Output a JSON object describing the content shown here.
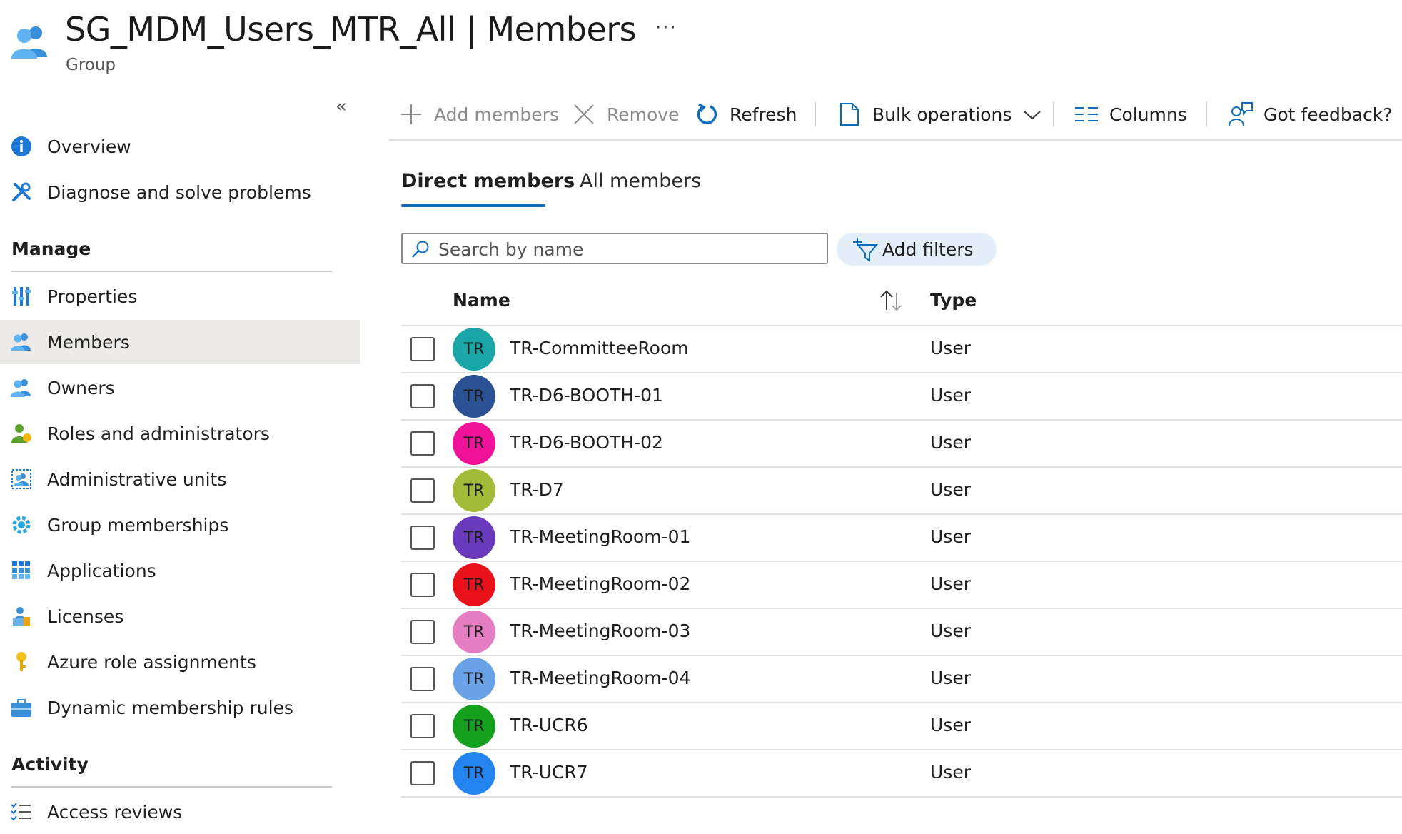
{
  "header": {
    "title": "SG_MDM_Users_MTR_All | Members",
    "subtitle": "Group",
    "more": "···",
    "collapse": "«"
  },
  "sidebar": {
    "top_items": [
      {
        "label": "Overview",
        "icon": "info-icon"
      },
      {
        "label": "Diagnose and solve problems",
        "icon": "wrench-icon"
      }
    ],
    "manage_heading": "Manage",
    "manage_items": [
      {
        "label": "Properties",
        "icon": "properties-icon"
      },
      {
        "label": "Members",
        "icon": "members-icon",
        "active": true
      },
      {
        "label": "Owners",
        "icon": "owners-icon"
      },
      {
        "label": "Roles and administrators",
        "icon": "roles-icon"
      },
      {
        "label": "Administrative units",
        "icon": "admin-units-icon"
      },
      {
        "label": "Group memberships",
        "icon": "group-memberships-icon"
      },
      {
        "label": "Applications",
        "icon": "applications-icon"
      },
      {
        "label": "Licenses",
        "icon": "licenses-icon"
      },
      {
        "label": "Azure role assignments",
        "icon": "key-icon"
      },
      {
        "label": "Dynamic membership rules",
        "icon": "toolbox-icon"
      }
    ],
    "activity_heading": "Activity",
    "activity_items": [
      {
        "label": "Access reviews",
        "icon": "checklist-icon"
      }
    ]
  },
  "toolbar": {
    "add_members": "Add members",
    "remove": "Remove",
    "refresh": "Refresh",
    "bulk_operations": "Bulk operations",
    "columns": "Columns",
    "feedback": "Got feedback?"
  },
  "tabs": {
    "direct": "Direct members",
    "all": "All members"
  },
  "search": {
    "placeholder": "Search by name",
    "value": ""
  },
  "filters": {
    "add_filters": "Add filters"
  },
  "table": {
    "columns": [
      "Name",
      "Type"
    ],
    "rows": [
      {
        "initials": "TR",
        "name": "TR-CommitteeRoom",
        "type": "User",
        "color": "#1aa6a6"
      },
      {
        "initials": "TR",
        "name": "TR-D6-BOOTH-01",
        "type": "User",
        "color": "#2c5296"
      },
      {
        "initials": "TR",
        "name": "TR-D6-BOOTH-02",
        "type": "User",
        "color": "#f0139a"
      },
      {
        "initials": "TR",
        "name": "TR-D7",
        "type": "User",
        "color": "#a4bb3a"
      },
      {
        "initials": "TR",
        "name": "TR-MeetingRoom-01",
        "type": "User",
        "color": "#6a3bbd"
      },
      {
        "initials": "TR",
        "name": "TR-MeetingRoom-02",
        "type": "User",
        "color": "#e9121b"
      },
      {
        "initials": "TR",
        "name": "TR-MeetingRoom-03",
        "type": "User",
        "color": "#e57dc2"
      },
      {
        "initials": "TR",
        "name": "TR-MeetingRoom-04",
        "type": "User",
        "color": "#6aa2e8"
      },
      {
        "initials": "TR",
        "name": "TR-UCR6",
        "type": "User",
        "color": "#14a01c"
      },
      {
        "initials": "TR",
        "name": "TR-UCR7",
        "type": "User",
        "color": "#2384ef"
      }
    ]
  },
  "colors": {
    "accent": "#0f6cbd",
    "active_nav_bg": "#ebeae9",
    "filter_pill_bg": "#e4eef8"
  }
}
